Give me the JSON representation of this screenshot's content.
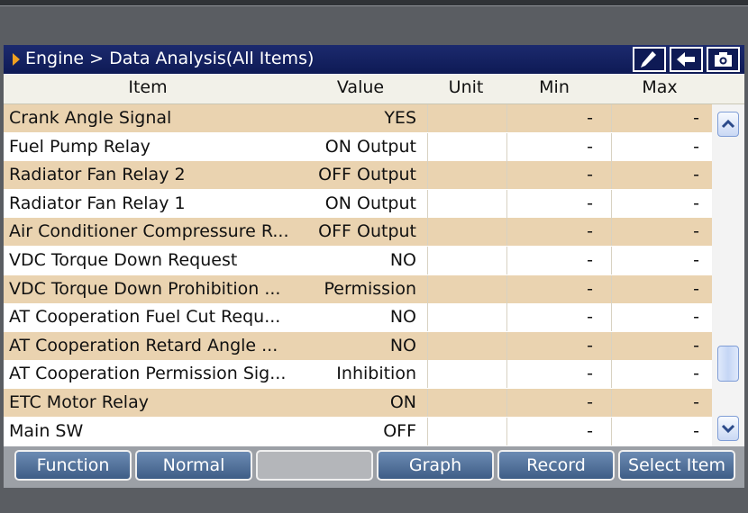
{
  "header": {
    "breadcrumb": "Engine > Data Analysis(All Items)"
  },
  "title_buttons": [
    {
      "icon": "pen-icon"
    },
    {
      "icon": "back-arrow-icon"
    },
    {
      "icon": "camera-icon"
    }
  ],
  "table": {
    "columns": [
      "Item",
      "Value",
      "Unit",
      "Min",
      "Max"
    ],
    "rows": [
      {
        "item": "Crank Angle Signal",
        "value": "YES",
        "unit": "",
        "min": "-",
        "max": "-"
      },
      {
        "item": "Fuel Pump Relay",
        "value": "ON Output",
        "unit": "",
        "min": "-",
        "max": "-"
      },
      {
        "item": "Radiator Fan Relay 2",
        "value": "OFF Output",
        "unit": "",
        "min": "-",
        "max": "-"
      },
      {
        "item": "Radiator Fan Relay 1",
        "value": "ON Output",
        "unit": "",
        "min": "-",
        "max": "-"
      },
      {
        "item": "Air Conditioner Compressure R...",
        "value": "OFF Output",
        "unit": "",
        "min": "-",
        "max": "-"
      },
      {
        "item": "VDC Torque Down Request",
        "value": "NO",
        "unit": "",
        "min": "-",
        "max": "-"
      },
      {
        "item": "VDC Torque Down Prohibition ...",
        "value": "Permission",
        "unit": "",
        "min": "-",
        "max": "-"
      },
      {
        "item": "AT Cooperation Fuel Cut Requ...",
        "value": "NO",
        "unit": "",
        "min": "-",
        "max": "-"
      },
      {
        "item": "AT Cooperation Retard Angle ...",
        "value": "NO",
        "unit": "",
        "min": "-",
        "max": "-"
      },
      {
        "item": "AT Cooperation Permission Sig...",
        "value": "Inhibition",
        "unit": "",
        "min": "-",
        "max": "-"
      },
      {
        "item": "ETC Motor Relay",
        "value": "ON",
        "unit": "",
        "min": "-",
        "max": "-"
      },
      {
        "item": "Main SW",
        "value": "OFF",
        "unit": "",
        "min": "-",
        "max": "-"
      }
    ]
  },
  "toolbar": {
    "buttons": [
      "Function",
      "Normal",
      "",
      "Graph",
      "Record",
      "Select Item"
    ]
  },
  "colors": {
    "title_bg": "#0e1a55",
    "accent_arrow": "#f0a020",
    "row_alt": "#ead3b0",
    "button": "#4d6d96"
  }
}
